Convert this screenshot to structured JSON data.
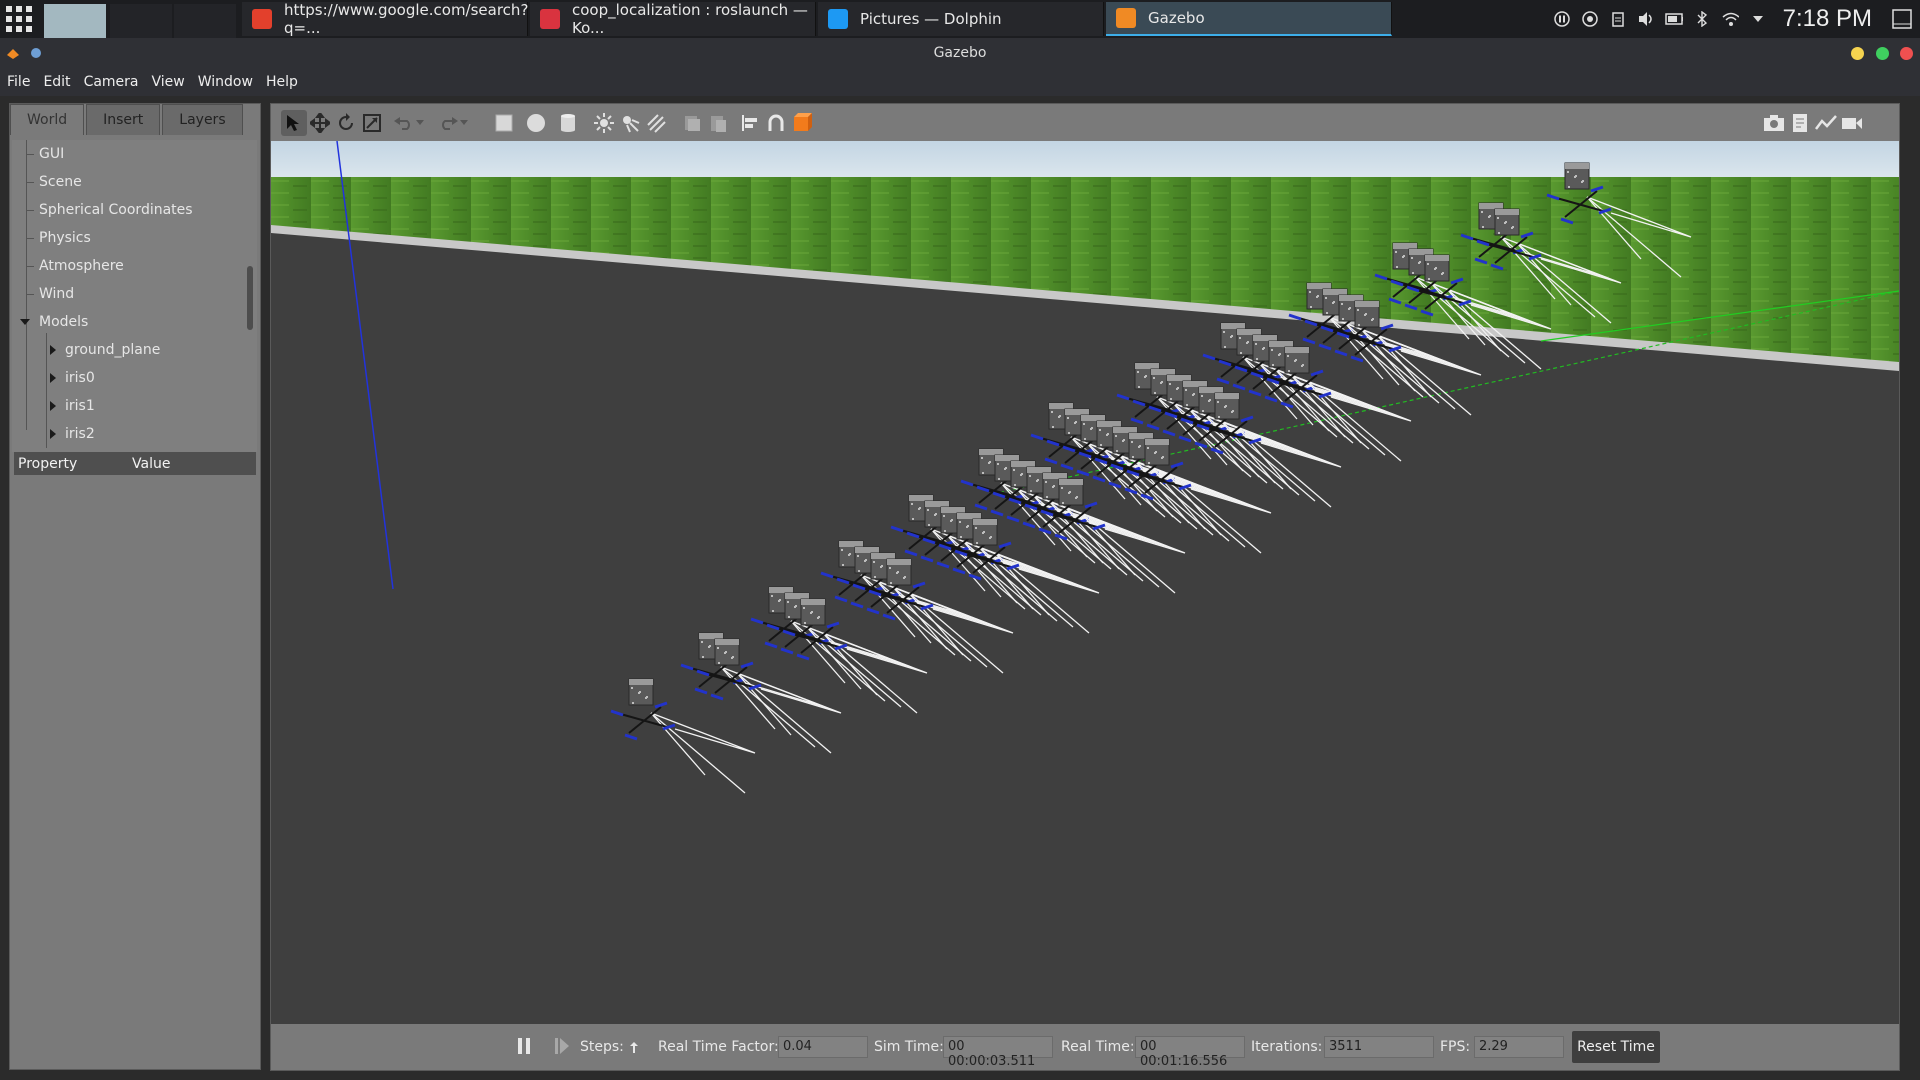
{
  "taskbar": {
    "tasks": [
      {
        "label": "https://www.google.com/search?q=...",
        "icon": "brave-browser-icon",
        "color": "#e3402c"
      },
      {
        "label": "coop_localization : roslaunch — Ko...",
        "icon": "konsole-terminal-icon",
        "color": "#d9333f"
      },
      {
        "label": "Pictures — Dolphin",
        "icon": "dolphin-folder-icon",
        "color": "#1d99f3"
      },
      {
        "label": "Gazebo",
        "icon": "gazebo-icon",
        "color": "#f08a24"
      }
    ],
    "clock": "7:18 PM"
  },
  "window": {
    "title": "Gazebo"
  },
  "menu": [
    "File",
    "Edit",
    "Camera",
    "View",
    "Window",
    "Help"
  ],
  "left_panel": {
    "tabs": [
      "World",
      "Insert",
      "Layers"
    ],
    "active_tab": "World",
    "tree": [
      "GUI",
      "Scene",
      "Spherical Coordinates",
      "Physics",
      "Atmosphere",
      "Wind"
    ],
    "models_label": "Models",
    "models": [
      "ground_plane",
      "iris0",
      "iris1",
      "iris2"
    ],
    "property_header": {
      "property": "Property",
      "value": "Value"
    }
  },
  "bottom_bar": {
    "steps_label": "Steps:",
    "rtf_label": "Real Time Factor:",
    "rtf_value": "0.04",
    "sim_time_label": "Sim Time:",
    "sim_time_value": "00 00:00:03.511",
    "real_time_label": "Real Time:",
    "real_time_value": "00 00:01:16.556",
    "iterations_label": "Iterations:",
    "iterations_value": "3511",
    "fps_label": "FPS:",
    "fps_value": "2.29",
    "reset_label": "Reset Time"
  },
  "colors": {
    "sky": "#c8d9e6",
    "grass": "#4f8a2a",
    "ground": "#3f3f3f",
    "accent": "#3daee9"
  }
}
